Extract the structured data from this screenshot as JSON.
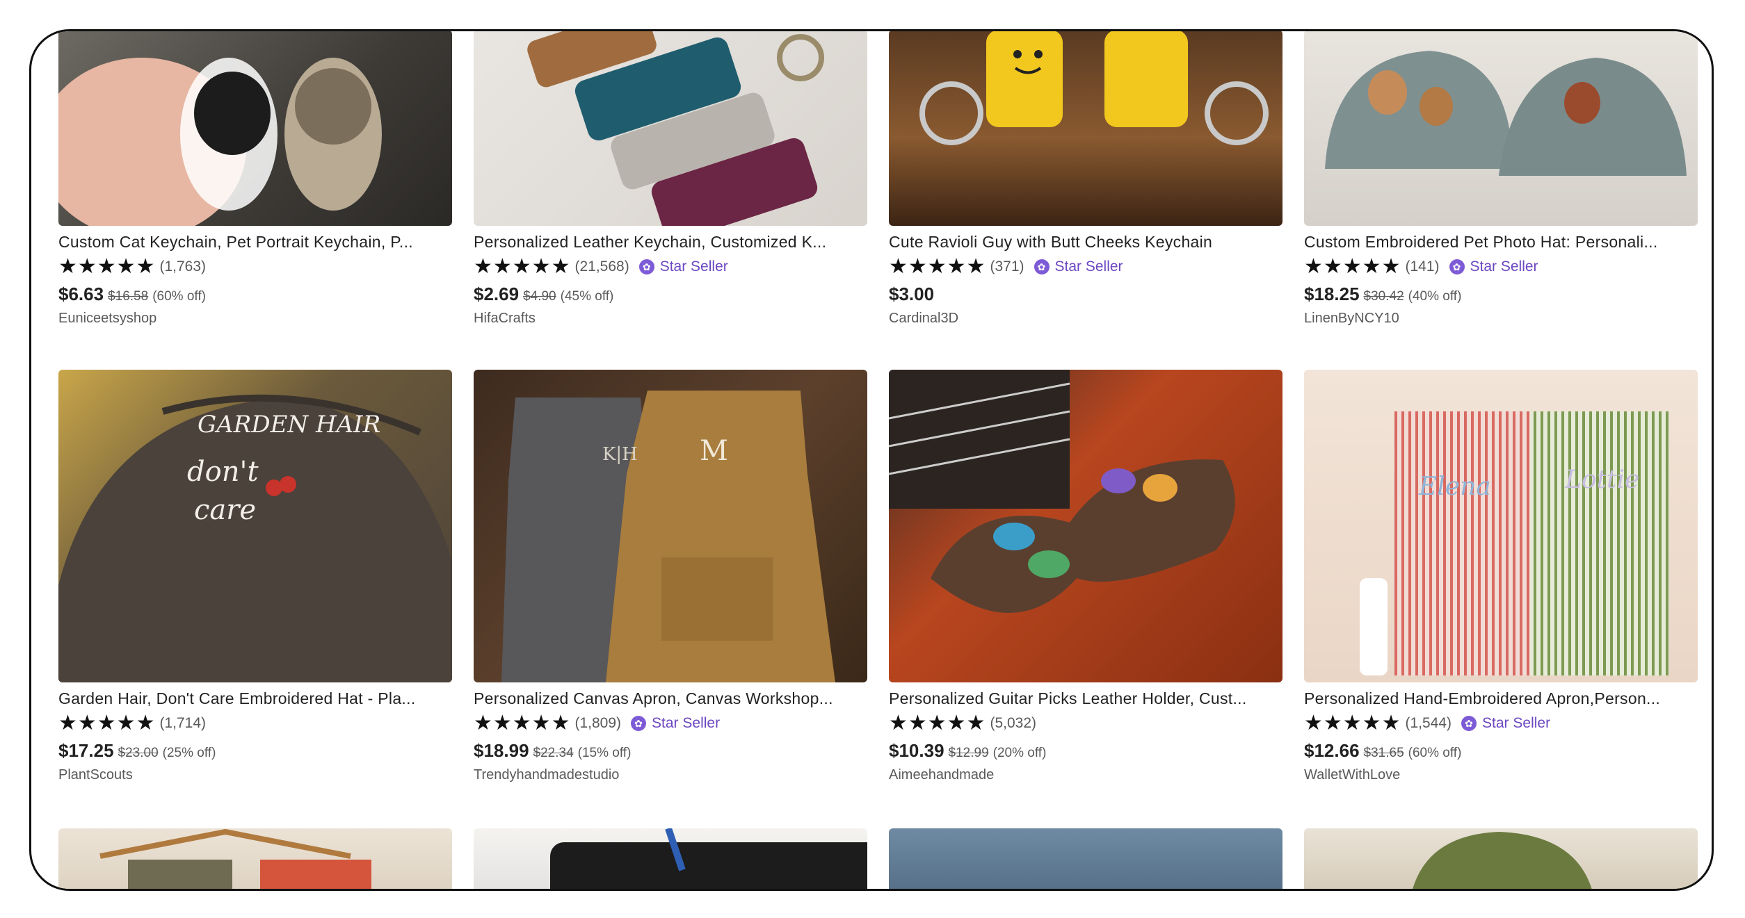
{
  "listings": [
    {
      "title": "Custom Cat Keychain, Pet Portrait Keychain, P...",
      "stars": "★★★★★",
      "reviews": "(1,763)",
      "star_seller": "",
      "price": "$6.63",
      "original_price": "$16.58",
      "discount": "(60% off)",
      "shop": "Euniceetsyshop"
    },
    {
      "title": "Personalized Leather Keychain, Customized K...",
      "stars": "★★★★★",
      "reviews": "(21,568)",
      "star_seller": "Star Seller",
      "price": "$2.69",
      "original_price": "$4.90",
      "discount": "(45% off)",
      "shop": "HifaCrafts"
    },
    {
      "title": "Cute Ravioli Guy with Butt Cheeks Keychain",
      "stars": "★★★★★",
      "reviews": "(371)",
      "star_seller": "Star Seller",
      "price": "$3.00",
      "original_price": "",
      "discount": "",
      "shop": "Cardinal3D"
    },
    {
      "title": "Custom Embroidered Pet Photo Hat: Personali...",
      "stars": "★★★★★",
      "reviews": "(141)",
      "star_seller": "Star Seller",
      "price": "$18.25",
      "original_price": "$30.42",
      "discount": "(40% off)",
      "shop": "LinenByNCY10"
    },
    {
      "title": "Garden Hair, Don't Care Embroidered Hat - Pla...",
      "stars": "★★★★★",
      "reviews": "(1,714)",
      "star_seller": "",
      "price": "$17.25",
      "original_price": "$23.00",
      "discount": "(25% off)",
      "shop": "PlantScouts"
    },
    {
      "title": "Personalized Canvas Apron, Canvas Workshop...",
      "stars": "★★★★★",
      "reviews": "(1,809)",
      "star_seller": "Star Seller",
      "price": "$18.99",
      "original_price": "$22.34",
      "discount": "(15% off)",
      "shop": "Trendyhandmadestudio"
    },
    {
      "title": "Personalized Guitar Picks Leather Holder, Cust...",
      "stars": "★★★★★",
      "reviews": "(5,032)",
      "star_seller": "",
      "price": "$10.39",
      "original_price": "$12.99",
      "discount": "(20% off)",
      "shop": "Aimeehandmade"
    },
    {
      "title": "Personalized Hand-Embroidered Apron,Person...",
      "stars": "★★★★★",
      "reviews": "(1,544)",
      "star_seller": "Star Seller",
      "price": "$12.66",
      "original_price": "$31.65",
      "discount": "(60% off)",
      "shop": "WalletWithLove"
    }
  ],
  "colors": {
    "star_seller": "#6b46c1",
    "text": "#222222",
    "muted": "#595959"
  },
  "icons": {
    "star_seller_badge": "star-seller-badge-icon"
  }
}
